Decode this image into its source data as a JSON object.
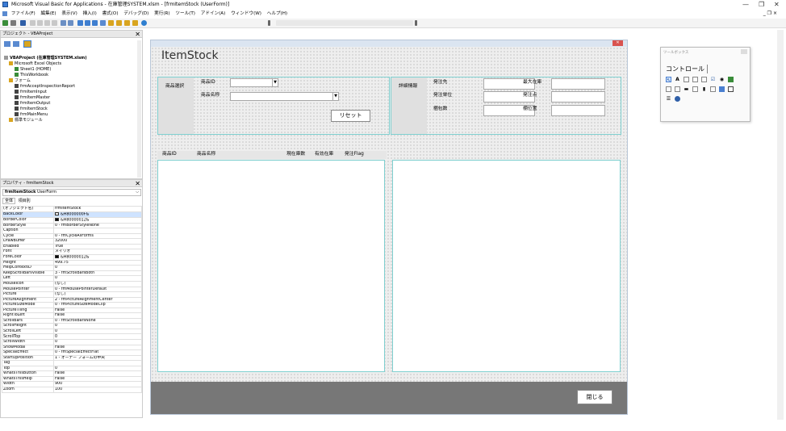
{
  "window": {
    "title": "Microsoft Visual Basic for Applications - 在庫管理SYSTEM.xlsm - [frmItemStock (UserForm)]",
    "minimize": "—",
    "maximize": "❐",
    "close": "✕",
    "inner_controls": "_ ❐ ×"
  },
  "menu": [
    "ファイル(F)",
    "編集(E)",
    "表示(V)",
    "挿入(I)",
    "書式(O)",
    "デバッグ(D)",
    "実行(R)",
    "ツール(T)",
    "アドイン(A)",
    "ウィンドウ(W)",
    "ヘルプ(H)"
  ],
  "project": {
    "title": "プロジェクト - VBAProject",
    "tree": [
      {
        "label": "VBAProject (在庫管理SYSTEM.xlsm)",
        "bold": true
      },
      {
        "label": "Microsoft Excel Objects"
      },
      {
        "label": "Sheet1 (HOME)"
      },
      {
        "label": "ThisWorkbook"
      },
      {
        "label": "フォーム"
      },
      {
        "label": "frmAcceptInspectionReport"
      },
      {
        "label": "frmItemInput"
      },
      {
        "label": "frmItemMaster"
      },
      {
        "label": "frmItemOutput"
      },
      {
        "label": "frmItemStock"
      },
      {
        "label": "frmMainMenu"
      },
      {
        "label": "標準モジュール"
      }
    ]
  },
  "properties": {
    "title": "プロパティ - frmItemStock",
    "object": "frmItemStock",
    "object_type": "UserForm",
    "tabs": [
      "全体",
      "項目別"
    ],
    "rows": [
      {
        "k": "(オブジェクト名)",
        "v": "frmItemStock"
      },
      {
        "k": "BackColor",
        "v": "&H8000000F&",
        "swatch": "#f0f0f0"
      },
      {
        "k": "BorderColor",
        "v": "&H80000012&",
        "swatch": "#000000"
      },
      {
        "k": "BorderStyle",
        "v": "0 - fmBorderStyleNone"
      },
      {
        "k": "Caption",
        "v": ""
      },
      {
        "k": "Cycle",
        "v": "0 - fmCycleAllForms"
      },
      {
        "k": "DrawBuffer",
        "v": "32000"
      },
      {
        "k": "Enabled",
        "v": "True"
      },
      {
        "k": "Font",
        "v": "メイリオ"
      },
      {
        "k": "ForeColor",
        "v": "&H80000012&",
        "swatch": "#000000"
      },
      {
        "k": "Height",
        "v": "499.75"
      },
      {
        "k": "HelpContextID",
        "v": "0"
      },
      {
        "k": "KeepScrollBarsVisible",
        "v": "3 - fmScrollBarsBoth"
      },
      {
        "k": "Left",
        "v": "0"
      },
      {
        "k": "MouseIcon",
        "v": "(なし)"
      },
      {
        "k": "MousePointer",
        "v": "0 - fmMousePointerDefault"
      },
      {
        "k": "Picture",
        "v": "(なし)"
      },
      {
        "k": "PictureAlignment",
        "v": "2 - fmPictureAlignmentCenter"
      },
      {
        "k": "PictureSizeMode",
        "v": "0 - fmPictureSizeModeClip"
      },
      {
        "k": "PictureTiling",
        "v": "False"
      },
      {
        "k": "RightToLeft",
        "v": "False"
      },
      {
        "k": "ScrollBars",
        "v": "0 - fmScrollBarsNone"
      },
      {
        "k": "ScrollHeight",
        "v": "0"
      },
      {
        "k": "ScrollLeft",
        "v": "0"
      },
      {
        "k": "ScrollTop",
        "v": "0"
      },
      {
        "k": "ScrollWidth",
        "v": "0"
      },
      {
        "k": "ShowModal",
        "v": "False"
      },
      {
        "k": "SpecialEffect",
        "v": "0 - fmSpecialEffectFlat"
      },
      {
        "k": "StartUpPosition",
        "v": "1 - オーナー フォームの中央"
      },
      {
        "k": "Tag",
        "v": ""
      },
      {
        "k": "Top",
        "v": "0"
      },
      {
        "k": "WhatsThisButton",
        "v": "False"
      },
      {
        "k": "WhatsThisHelp",
        "v": "False"
      },
      {
        "k": "Width",
        "v": "900"
      },
      {
        "k": "Zoom",
        "v": "100"
      }
    ]
  },
  "form": {
    "title": "ItemStock",
    "section_select": "商品選択",
    "item_id_label": "商品ID",
    "item_name_label": "商品名称",
    "reset_button": "リセット",
    "section_detail": "詳細情報",
    "detail_labels": [
      "発注先",
      "発注単位",
      "梱包数",
      "最大在庫",
      "発注点",
      "棚位置"
    ],
    "list_headers": [
      "商品ID",
      "商品名称",
      "現在庫数",
      "有効在庫",
      "発注Flag"
    ],
    "close_button": "閉じる"
  },
  "toolbox": {
    "title": "ツールボックス",
    "tab": "コントロール"
  }
}
